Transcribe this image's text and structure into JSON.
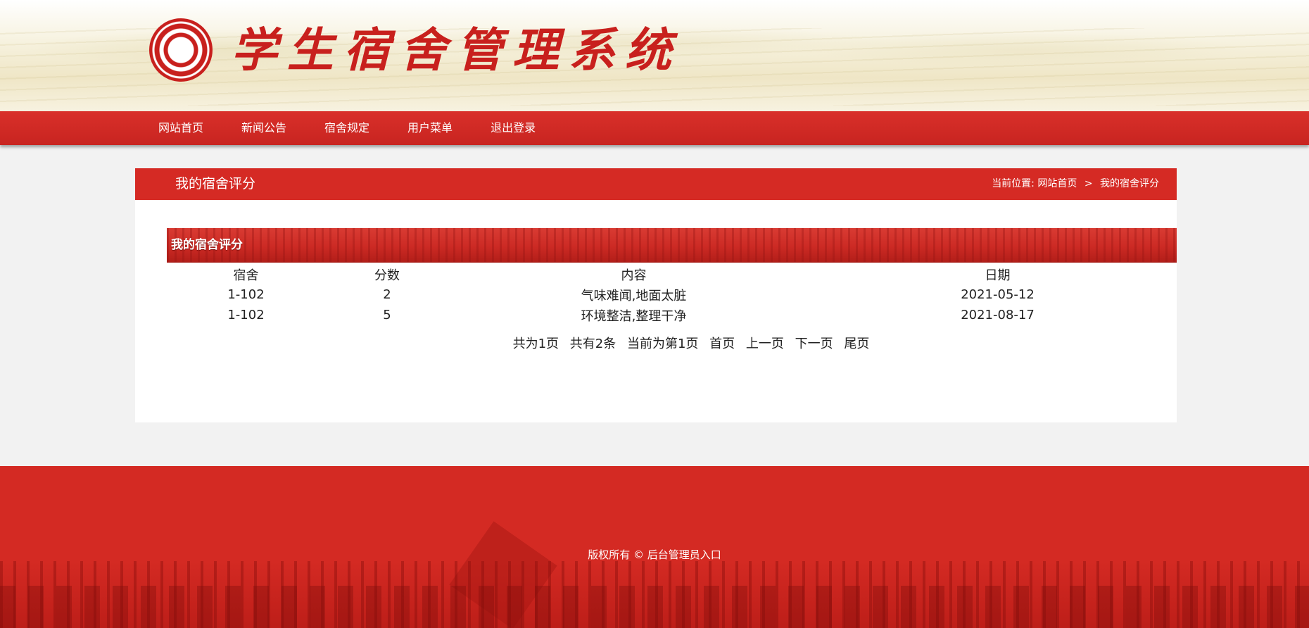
{
  "site": {
    "title": "学生宿舍管理系统"
  },
  "nav": {
    "items": [
      "网站首页",
      "新闻公告",
      "宿舍规定",
      "用户菜单",
      "退出登录"
    ]
  },
  "page": {
    "title": "我的宿舍评分",
    "breadcrumb": {
      "prefix": "当前位置:",
      "home": "网站首页",
      "sep": ">",
      "current": "我的宿舍评分"
    }
  },
  "section": {
    "title": "我的宿舍评分"
  },
  "table": {
    "headers": [
      "宿舍",
      "分数",
      "内容",
      "日期"
    ],
    "rows": [
      [
        "1-102",
        "2",
        "气味难闻,地面太脏",
        "2021-05-12"
      ],
      [
        "1-102",
        "5",
        "环境整洁,整理干净",
        "2021-08-17"
      ]
    ]
  },
  "pager": {
    "total_pages": "共为1页",
    "total_items": "共有2条",
    "current": "当前为第1页",
    "first": "首页",
    "prev": "上一页",
    "next": "下一页",
    "last": "尾页"
  },
  "footer": {
    "copyright": "版权所有 ©",
    "admin_link": "后台管理员入口"
  },
  "colors": {
    "brand_red": "#d42a23",
    "nav_red": "#c82420",
    "background": "#f2f2f2"
  }
}
